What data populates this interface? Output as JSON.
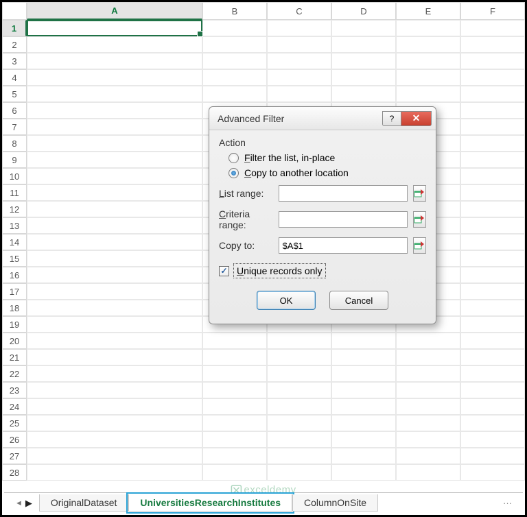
{
  "columns": [
    "A",
    "B",
    "C",
    "D",
    "E",
    "F"
  ],
  "rowCount": 28,
  "activeCell": "A1",
  "dialog": {
    "title": "Advanced Filter",
    "help": "?",
    "close": "✕",
    "action_label": "Action",
    "radio1": {
      "prefix": "F",
      "rest": "ilter the list, in-place",
      "checked": false
    },
    "radio2": {
      "prefix": "C",
      "rest": "opy to another location",
      "checked": true
    },
    "listrange_label_pref": "L",
    "listrange_label_rest": "ist range:",
    "listrange_value": "",
    "criteria_label_pref": "C",
    "criteria_label_rest": "riteria range:",
    "criteria_value": "",
    "copyto_label": "Copy to:",
    "copyto_value": "$A$1",
    "unique_checked": true,
    "unique_label_pref": "U",
    "unique_label_rest": "nique records only",
    "ok": "OK",
    "cancel": "Cancel"
  },
  "tabs": {
    "t1": "OriginalDataset",
    "t2": "UniversitiesResearchInstitutes",
    "t3": "ColumnOnSite"
  },
  "watermark": "exceldemy"
}
